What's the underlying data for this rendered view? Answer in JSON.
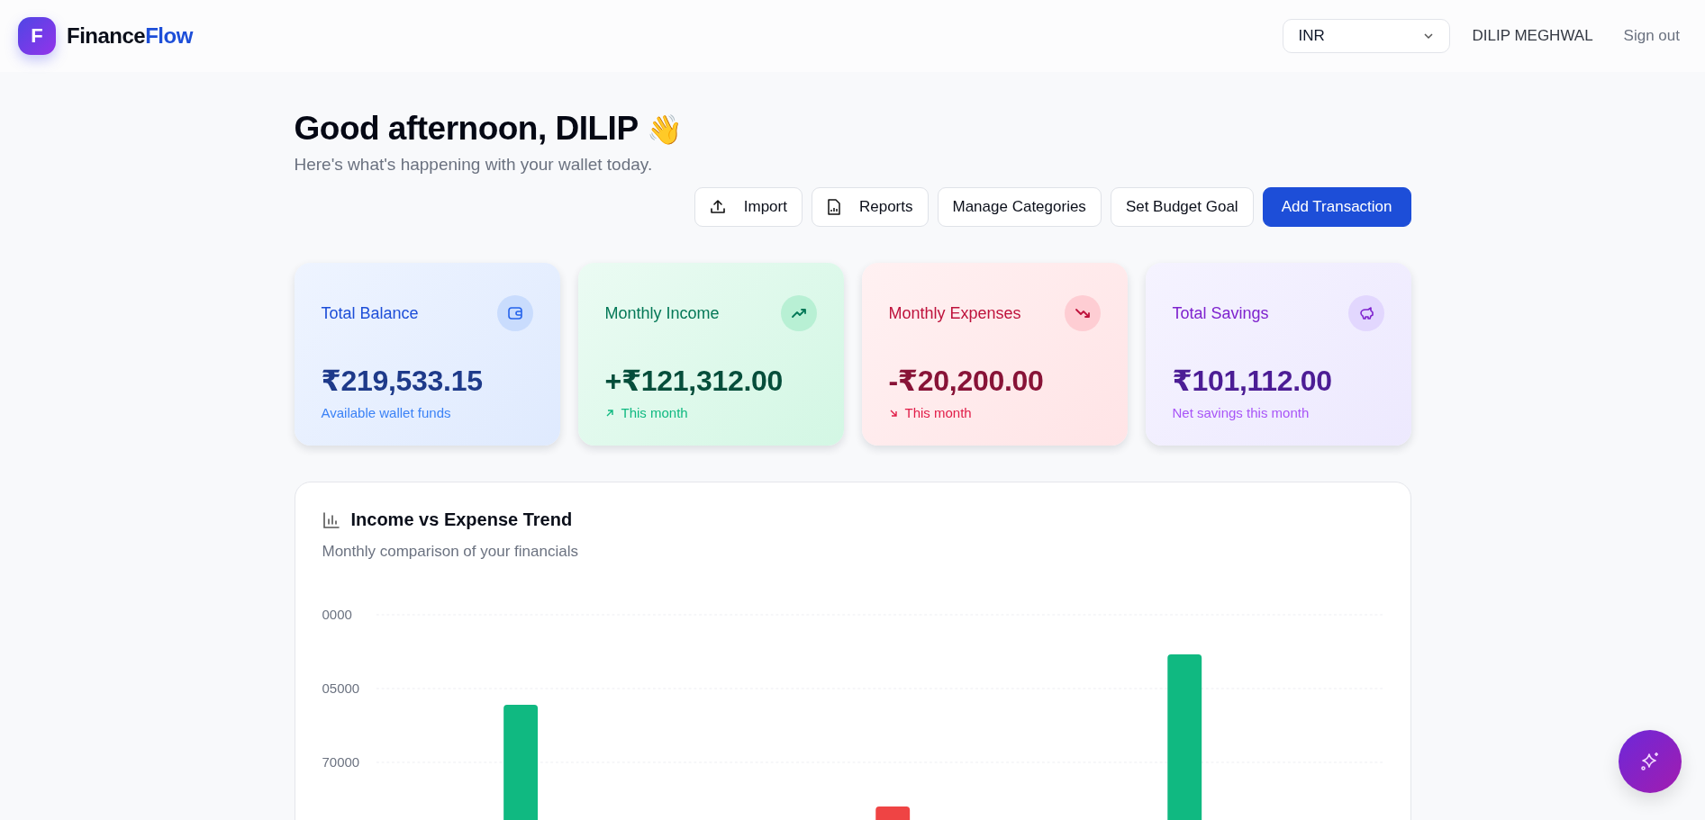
{
  "header": {
    "logo_letter": "F",
    "brand": {
      "part1": "Finance",
      "part2": "Flow"
    },
    "currency": {
      "value": "INR"
    },
    "user_name": "DILIP MEGHWAL",
    "sign_out": "Sign out"
  },
  "greeting": {
    "title": "Good afternoon, DILIP",
    "emoji": "👋",
    "subtitle": "Here's what's happening with your wallet today."
  },
  "actions": [
    {
      "label": "Import",
      "kind": "upload"
    },
    {
      "label": "Reports",
      "kind": "report"
    },
    {
      "label": "Manage Categories",
      "kind": "plain"
    },
    {
      "label": "Set Budget Goal",
      "kind": "plain"
    },
    {
      "label": "Add Transaction",
      "kind": "primary"
    }
  ],
  "cards": [
    {
      "title": "Total Balance",
      "value": "₹219,533.15",
      "note": "Available wallet funds",
      "kind": "balance"
    },
    {
      "title": "Monthly Income",
      "value": "+₹121,312.00",
      "note": "This month",
      "kind": "income"
    },
    {
      "title": "Monthly Expenses",
      "value": "-₹20,200.00",
      "note": "This month",
      "kind": "expense"
    },
    {
      "title": "Total Savings",
      "value": "₹101,112.00",
      "note": "Net savings this month",
      "kind": "savings"
    }
  ],
  "trend_panel": {
    "title": "Income vs Expense Trend",
    "subtitle": "Monthly comparison of your financials",
    "y_tick_labels": [
      "0000",
      "05000",
      "70000"
    ]
  }
}
